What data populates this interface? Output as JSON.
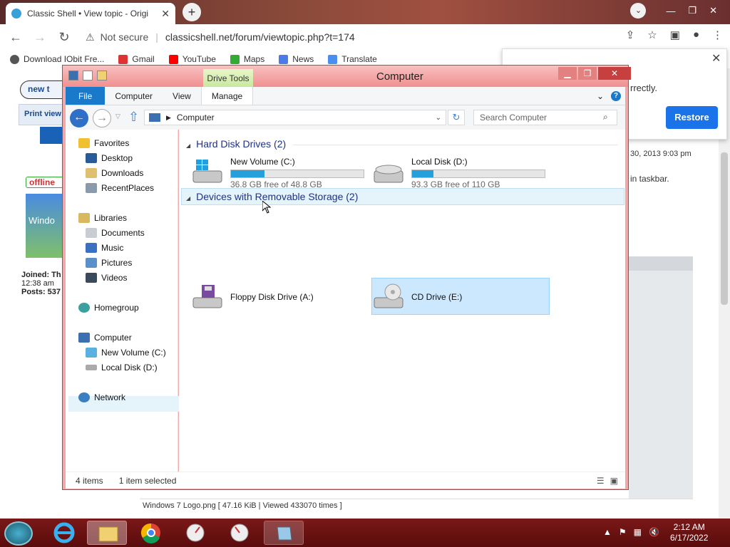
{
  "browser": {
    "tab_title": "Classic Shell • View topic - Origi",
    "url_security": "Not secure",
    "url": "classicshell.net/forum/viewtopic.php?t=174",
    "bookmarks": [
      "Download IObit Fre...",
      "Gmail",
      "YouTube",
      "Maps",
      "News",
      "Translate"
    ],
    "restore_text": "rrectly.",
    "restore_button": "Restore"
  },
  "webpage": {
    "new_btn": "new t",
    "print_view": "Print view",
    "offline": "offline",
    "winlogo": "Windo",
    "joined": "Joined: Th",
    "joined_time": "12:38 am",
    "posts": "Posts: 537",
    "date_text": "30, 2013 9:03 pm",
    "taskbar_text": "in taskbar.",
    "file_caption": "Windows 7 Logo.png [ 47.16 KiB | Viewed 433070 times ]"
  },
  "explorer": {
    "title": "Computer",
    "drive_tools": "Drive Tools",
    "ribbon_tabs": [
      "File",
      "Computer",
      "View",
      "Manage"
    ],
    "address": "Computer",
    "search_placeholder": "Search Computer",
    "nav": {
      "favorites": "Favorites",
      "fav_items": [
        "Desktop",
        "Downloads",
        "RecentPlaces"
      ],
      "libraries": "Libraries",
      "lib_items": [
        "Documents",
        "Music",
        "Pictures",
        "Videos"
      ],
      "homegroup": "Homegroup",
      "computer": "Computer",
      "comp_items": [
        "New Volume (C:)",
        "Local Disk (D:)"
      ],
      "network": "Network"
    },
    "groups": {
      "hdd": "Hard Disk Drives (2)",
      "removable": "Devices with Removable Storage (2)"
    },
    "drives": [
      {
        "name": "New Volume (C:)",
        "free": "36.8 GB free of 48.8 GB",
        "used_fraction": 0.25
      },
      {
        "name": "Local Disk (D:)",
        "free": "93.3 GB free of 110 GB",
        "used_fraction": 0.16
      }
    ],
    "removable": [
      {
        "name": "Floppy Disk Drive (A:)"
      },
      {
        "name": "CD Drive (E:)"
      }
    ],
    "status": {
      "items": "4 items",
      "selected": "1 item selected"
    }
  },
  "taskbar": {
    "time": "2:12 AM",
    "date": "6/17/2022"
  }
}
